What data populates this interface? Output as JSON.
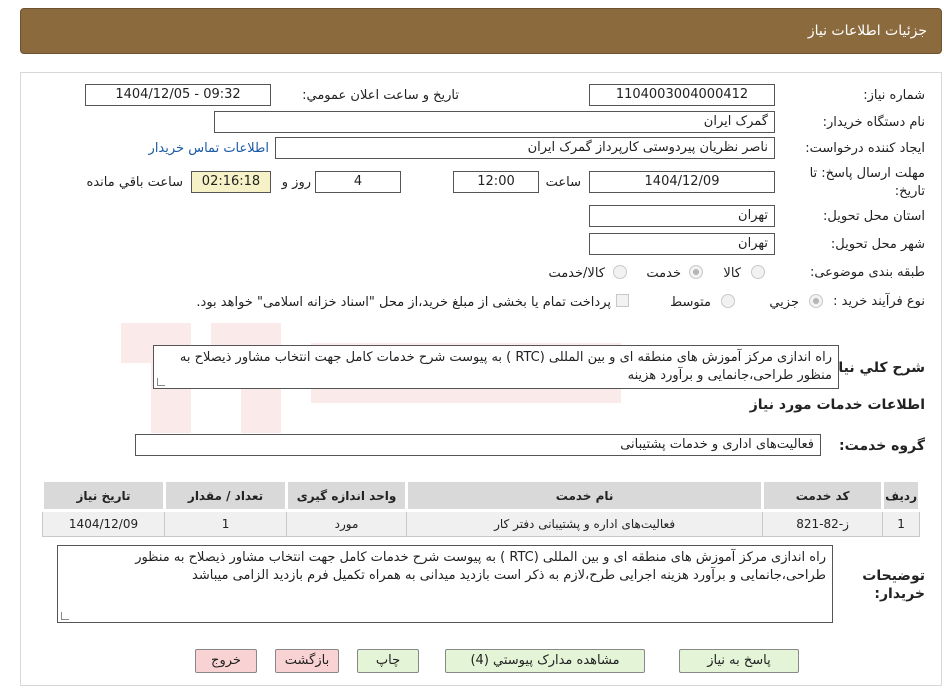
{
  "header": {
    "title": "جزئیات اطلاعات نیاز"
  },
  "form": {
    "need_number": {
      "label": "شماره نیاز:",
      "value": "1104003004000412"
    },
    "announce_datetime": {
      "label": "تاريخ و ساعت اعلان عمومي:",
      "value": "1404/12/05 - 09:32"
    },
    "buyer_org": {
      "label": "نام دستگاه خريدار:",
      "value": "گمرک ایران"
    },
    "requester": {
      "label": "ايجاد کننده درخواست:",
      "value": "ناصر نظریان پیردوستی کارپرداز گمرک ایران"
    },
    "contact_link": "اطلاعات تماس خريدار",
    "deadline": {
      "label_line1": "مهلت ارسال پاسخ: تا",
      "label_line2": "تاريخ:",
      "date": "1404/12/09",
      "time_label": "ساعت",
      "time": "12:00",
      "days": "4",
      "days_label": "روز و",
      "remaining": "02:16:18",
      "remaining_label": "ساعت باقي مانده"
    },
    "province": {
      "label": "استان محل تحویل:",
      "value": "تهران"
    },
    "city": {
      "label": "شهر محل تحویل:",
      "value": "تهران"
    },
    "category": {
      "label": "طبقه بندی موضوعی:",
      "options": [
        "كالا",
        "خدمت",
        "كالا/خدمت"
      ],
      "selected": "خدمت"
    },
    "purchase_type": {
      "label": "نوع فرآيند خريد :",
      "options": [
        "جزيي",
        "متوسط"
      ],
      "selected": "جزيي",
      "note": "پرداخت تمام یا بخشی از مبلغ خرید،از محل \"اسناد خزانه اسلامی\" خواهد بود."
    },
    "general_desc": {
      "label": "شرح كلي نياز:",
      "value": "راه اندازی مرکز آموزش های منطقه ای و بین المللی (RTC ) به پیوست شرح خدمات کامل جهت انتخاب مشاور ذیصلاح به منظور طراحی،جانمایی و برآورد هزینه"
    }
  },
  "services": {
    "section_title": "اطلاعات خدمات مورد نياز",
    "group_label": "گروه خدمت:",
    "group_value": "فعالیت‌های اداری و خدمات پشتیبانی",
    "columns": [
      "رديف",
      "کد خدمت",
      "نام خدمت",
      "واحد اندازه گیری",
      "تعداد / مقدار",
      "تاريخ نياز"
    ],
    "rows": [
      [
        "1",
        "ز-82-821",
        "فعالیت‌های اداره و پشتیبانی دفتر کار",
        "مورد",
        "1",
        "1404/12/09"
      ]
    ]
  },
  "buyer_notes": {
    "label_line1": "توضيحات",
    "label_line2": "خريدار:",
    "value": "راه اندازی مرکز آموزش های منطقه ای و بین المللی (RTC ) به پیوست شرح خدمات کامل جهت انتخاب مشاور ذیصلاح به منظور طراحی،جانمایی و برآورد هزینه اجرایی طرح،لازم به ذکر است بازدید میدانی به همراه تکمیل فرم بازدید الزامی میباشد"
  },
  "buttons": {
    "reply": "پاسخ به نياز",
    "view_docs": "مشاهده مدارک پيوستي (4)",
    "print": "چاپ",
    "back": "بازگشت",
    "exit": "خروج"
  },
  "colors": {
    "header": "#8b6a3e",
    "button_green": "#e3f4d7",
    "button_red": "#f9d3d3",
    "highlight": "#f6f1c7"
  }
}
